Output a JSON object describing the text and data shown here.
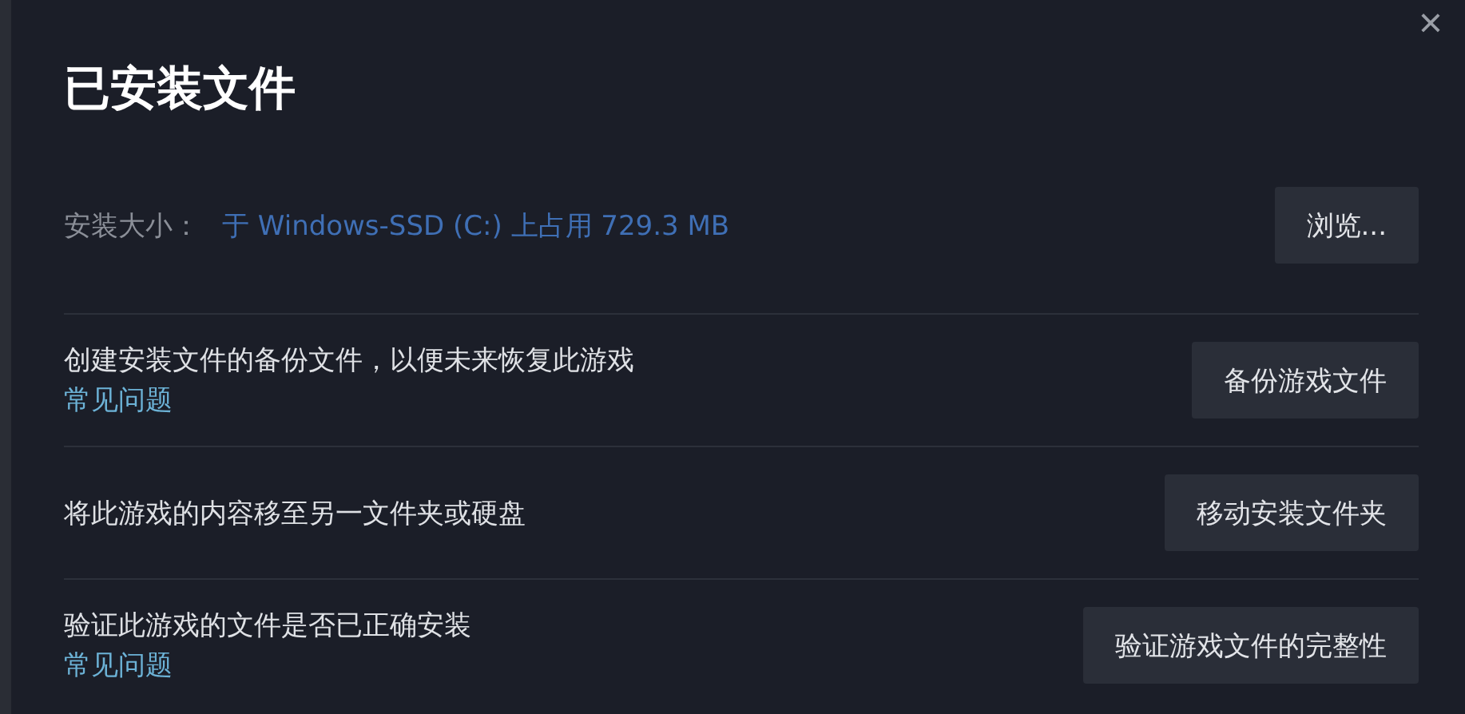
{
  "dialog": {
    "title": "已安装文件",
    "close": "×"
  },
  "rows": [
    {
      "kind": "size",
      "label": "安装大小：",
      "value": "于 Windows-SSD (C:) 上占用 729.3 MB",
      "button": "浏览..."
    },
    {
      "kind": "action",
      "text": "创建安装文件的备份文件，以便未来恢复此游戏",
      "link": "常见问题",
      "button": "备份游戏文件"
    },
    {
      "kind": "action",
      "text": "将此游戏的内容移至另一文件夹或硬盘",
      "button": "移动安装文件夹"
    },
    {
      "kind": "action",
      "text": "验证此游戏的文件是否已正确安装",
      "link": "常见问题",
      "button": "验证游戏文件的完整性"
    }
  ]
}
